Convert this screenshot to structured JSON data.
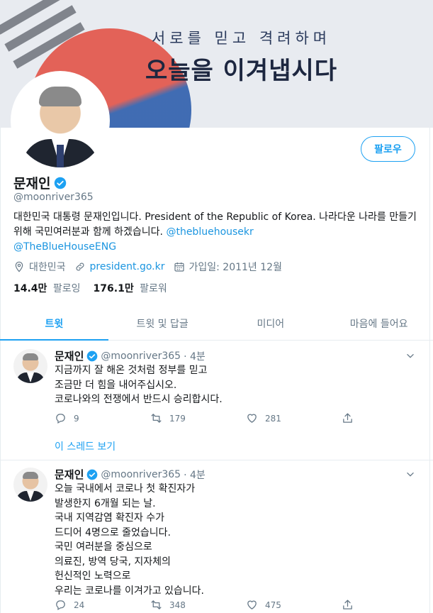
{
  "banner": {
    "line1": "서로를 믿고 격려하며",
    "line2": "오늘을 이겨냅시다"
  },
  "profile": {
    "follow_label": "팔로우",
    "name": "문재인",
    "handle": "@moonriver365",
    "bio_line1": "대한민국 대통령 문재인입니다. President of the Republic of Korea. 나라다운 나라",
    "bio_line2": "를 만들기 위해 국민여러분과 함께 하겠습니다. ",
    "bio_mention1": "@thebluehousekr",
    "bio_mention2": "@TheBlueHouseENG",
    "location": "대한민국",
    "website": "president.go.kr",
    "joined": "가입일: 2011년 12월",
    "following_count": "14.4만",
    "following_label": "팔로잉",
    "followers_count": "176.1만",
    "followers_label": "팔로워"
  },
  "tabs": [
    {
      "label": "트윗"
    },
    {
      "label": "트윗 및 답글"
    },
    {
      "label": "미디어"
    },
    {
      "label": "마음에 들어요"
    }
  ],
  "tweets": [
    {
      "name": "문재인",
      "handle": "@moonriver365",
      "time": "· 4분",
      "text": "지금까지 잘 해온 것처럼 정부를 믿고\n조금만 더 힘을 내어주십시오.\n코로나와의 전쟁에서 반드시 승리합시다.",
      "replies": "9",
      "retweets": "179",
      "likes": "281",
      "thread_link": "이 스레드 보기"
    },
    {
      "name": "문재인",
      "handle": "@moonriver365",
      "time": "· 4분",
      "text": "오늘 국내에서 코로나 첫 확진자가\n발생한지 6개월 되는 날.\n국내 지역감염 확진자 수가\n드디어 4명으로 줄었습니다.\n국민 여러분을 중심으로\n의료진, 방역 당국, 지자체의\n헌신적인 노력으로\n우리는 코로나를 이겨가고 있습니다.",
      "replies": "24",
      "retweets": "348",
      "likes": "475"
    }
  ],
  "colors": {
    "accent": "#1da1f2",
    "link": "#1b95e0",
    "secondary_text": "#657786",
    "border": "#e6ecf0"
  },
  "icons": {
    "verified": "verified-badge-icon",
    "location": "location-pin-icon",
    "link": "link-icon",
    "calendar": "calendar-icon",
    "reply": "reply-icon",
    "retweet": "retweet-icon",
    "like": "heart-icon",
    "share": "share-icon",
    "more": "chevron-down-icon"
  }
}
